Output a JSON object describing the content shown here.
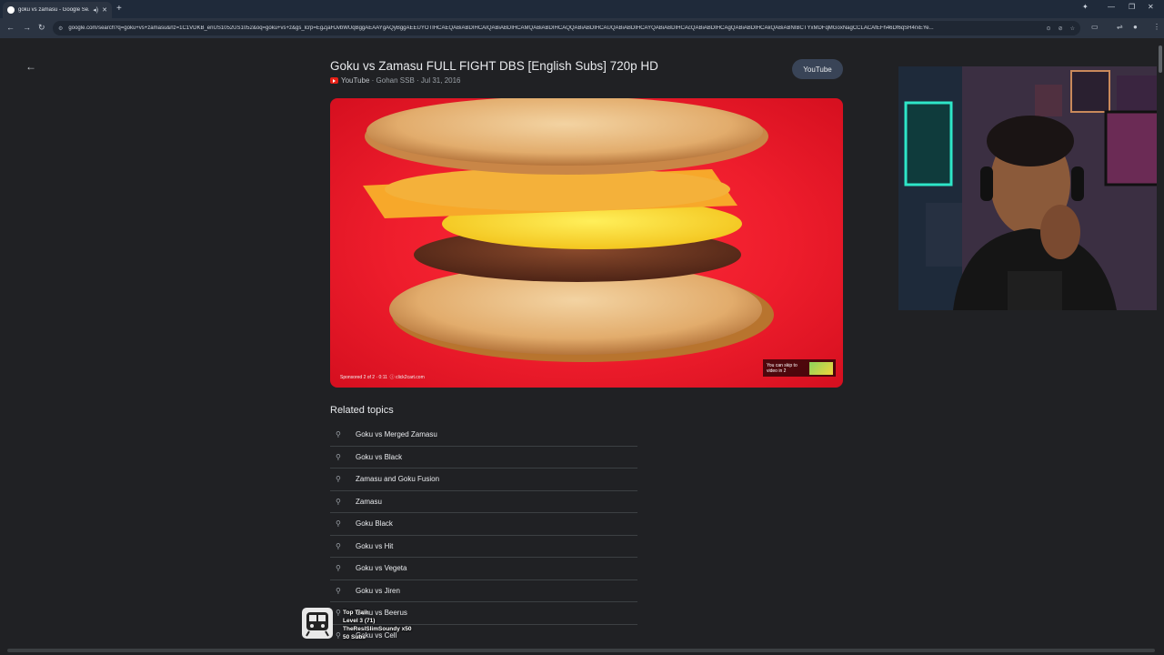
{
  "browser": {
    "tab": {
      "title": "goku vs zamasu - Google Se..."
    },
    "url": "google.com/search?q=goku+vs+zamasu&rlz=1C1VDKB_enUS1052US1052&oq=goku+vs+z&gs_lcrp=EgZjaHJvbWUqBggAEAAYgAQyBggAEEUYOTIHCAEQABiABDIHCAIQABiABDIHCAMQABiABDIHCAQQABiABDIHCAUQABiABDIHCAYQABiABDIHCAcQABiABDIHCAgQABiABDIHCAkQABiABNIBCTYxMDFqMGoxNagCCLACAfEFh46Df6qSH4rxEYe..."
  },
  "result": {
    "title": "Goku vs Zamasu FULL FIGHT DBS [English Subs] 720p HD",
    "source": "YouTube",
    "channel": "Gohan SSB",
    "date": "Jul 31, 2016",
    "button_label": "YouTube"
  },
  "video": {
    "sponsored_text": "Sponsored 2 of 2 · 0:11",
    "advertiser": "click2cart.com",
    "skip_text_line1": "You can skip to",
    "skip_text_line2": "video in 2"
  },
  "related": {
    "heading": "Related topics",
    "items": [
      "Goku vs Merged Zamasu",
      "Goku vs Black",
      "Zamasu and Goku Fusion",
      "Zamasu",
      "Goku Black",
      "Goku vs Hit",
      "Goku vs Vegeta",
      "Goku vs Jiren",
      "Goku vs Beerus",
      "Goku vs Cell"
    ]
  },
  "stream_overlay": {
    "line1": "Top Train",
    "line2": "Level 3  (71)",
    "line3": "TheReslSlimSoundy x50",
    "line4": "50 Subs"
  },
  "colors": {
    "video_bg": "#ee1d2c",
    "page_bg": "#202124",
    "youtube_red": "#e62117"
  }
}
